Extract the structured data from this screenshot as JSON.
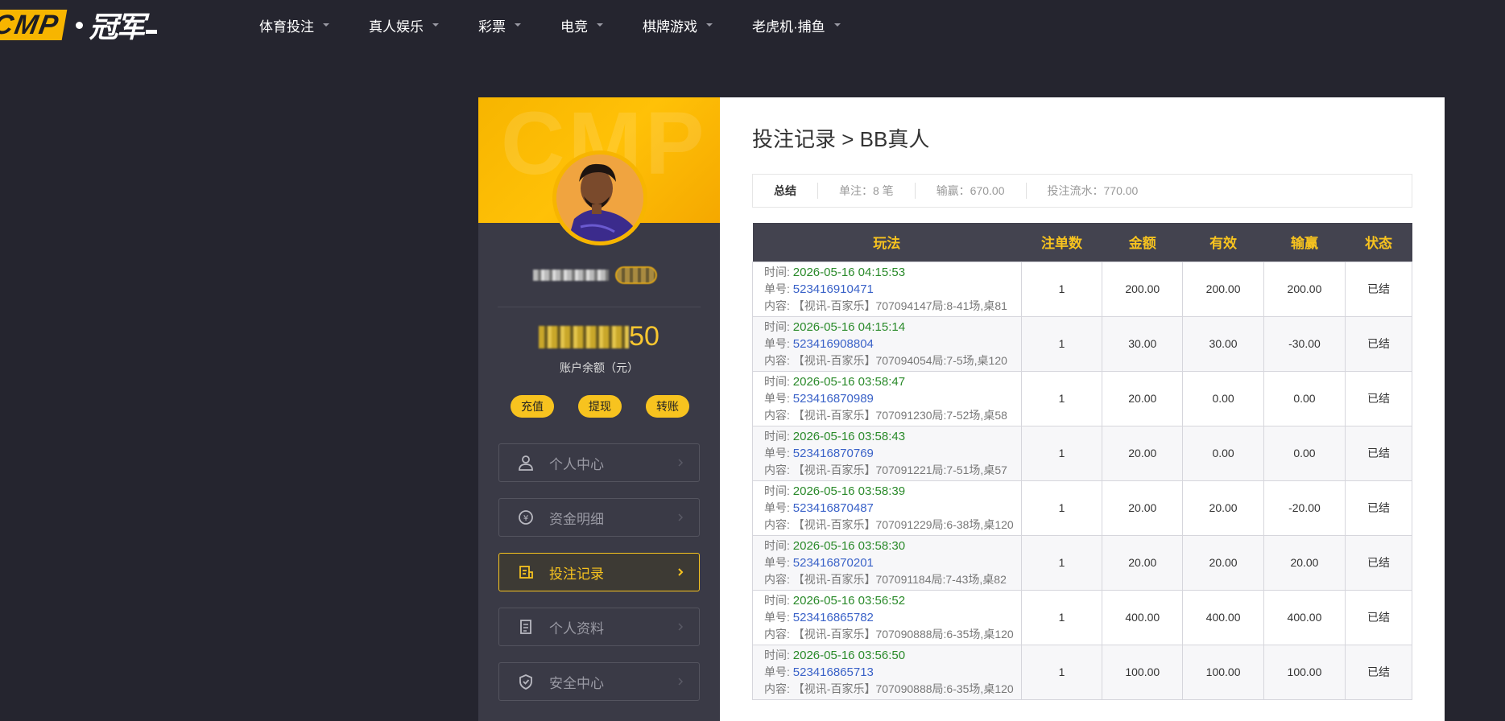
{
  "header": {
    "logo_text": "CMP",
    "logo_cn": "冠军",
    "nav": [
      {
        "label": "体育投注"
      },
      {
        "label": "真人娱乐"
      },
      {
        "label": "彩票"
      },
      {
        "label": "电竞"
      },
      {
        "label": "棋牌游戏"
      },
      {
        "label": "老虎机·捕鱼"
      }
    ]
  },
  "sidebar": {
    "watermark": "CMP",
    "balance_suffix": "50",
    "balance_label": "账户余额（元）",
    "actions": {
      "deposit": "充值",
      "withdraw": "提现",
      "transfer": "转账"
    },
    "menu": [
      {
        "label": "个人中心",
        "icon": "user-icon"
      },
      {
        "label": "资金明细",
        "icon": "yen-exchange-icon"
      },
      {
        "label": "投注记录",
        "icon": "bet-record-icon",
        "active": true
      },
      {
        "label": "个人资料",
        "icon": "profile-doc-icon"
      },
      {
        "label": "安全中心",
        "icon": "shield-icon"
      }
    ]
  },
  "main": {
    "title": "投注记录 > BB真人",
    "summary": {
      "label": "总结",
      "count": "单注：8 笔",
      "winloss": "输赢：670.00",
      "turnover": "投注流水：770.00"
    },
    "table": {
      "headers": [
        "玩法",
        "注单数",
        "金额",
        "有效",
        "输赢",
        "状态"
      ],
      "time_label": "时间:",
      "order_label": "单号:",
      "content_label": "内容:",
      "rows": [
        {
          "time": "2026-05-16 04:15:53",
          "order": "523416910471",
          "content": "【视讯-百家乐】707094147局:8-41场,桌81",
          "count": "1",
          "amount": "200.00",
          "valid": "200.00",
          "winloss": "200.00",
          "sign": "pos",
          "status": "已结"
        },
        {
          "time": "2026-05-16 04:15:14",
          "order": "523416908804",
          "content": "【视讯-百家乐】707094054局:7-5场,桌120",
          "count": "1",
          "amount": "30.00",
          "valid": "30.00",
          "winloss": "-30.00",
          "sign": "neg",
          "status": "已结"
        },
        {
          "time": "2026-05-16 03:58:47",
          "order": "523416870989",
          "content": "【视讯-百家乐】707091230局:7-52场,桌58",
          "count": "1",
          "amount": "20.00",
          "valid": "0.00",
          "winloss": "0.00",
          "sign": "zero",
          "status": "已结"
        },
        {
          "time": "2026-05-16 03:58:43",
          "order": "523416870769",
          "content": "【视讯-百家乐】707091221局:7-51场,桌57",
          "count": "1",
          "amount": "20.00",
          "valid": "0.00",
          "winloss": "0.00",
          "sign": "zero",
          "status": "已结"
        },
        {
          "time": "2026-05-16 03:58:39",
          "order": "523416870487",
          "content": "【视讯-百家乐】707091229局:6-38场,桌120",
          "count": "1",
          "amount": "20.00",
          "valid": "20.00",
          "winloss": "-20.00",
          "sign": "neg",
          "status": "已结"
        },
        {
          "time": "2026-05-16 03:58:30",
          "order": "523416870201",
          "content": "【视讯-百家乐】707091184局:7-43场,桌82",
          "count": "1",
          "amount": "20.00",
          "valid": "20.00",
          "winloss": "20.00",
          "sign": "pos",
          "status": "已结"
        },
        {
          "time": "2026-05-16 03:56:52",
          "order": "523416865782",
          "content": "【视讯-百家乐】707090888局:6-35场,桌120",
          "count": "1",
          "amount": "400.00",
          "valid": "400.00",
          "winloss": "400.00",
          "sign": "pos",
          "status": "已结"
        },
        {
          "time": "2026-05-16 03:56:50",
          "order": "523416865713",
          "content": "【视讯-百家乐】707090888局:6-35场,桌120",
          "count": "1",
          "amount": "100.00",
          "valid": "100.00",
          "winloss": "100.00",
          "sign": "pos",
          "status": "已结"
        }
      ]
    }
  },
  "colors": {
    "accent": "#f7c31f",
    "sidebar_bg": "#3a3a46",
    "page_bg": "#25252f",
    "positive": "#2a8a2a",
    "negative": "#e02020",
    "link": "#3a62c8"
  }
}
